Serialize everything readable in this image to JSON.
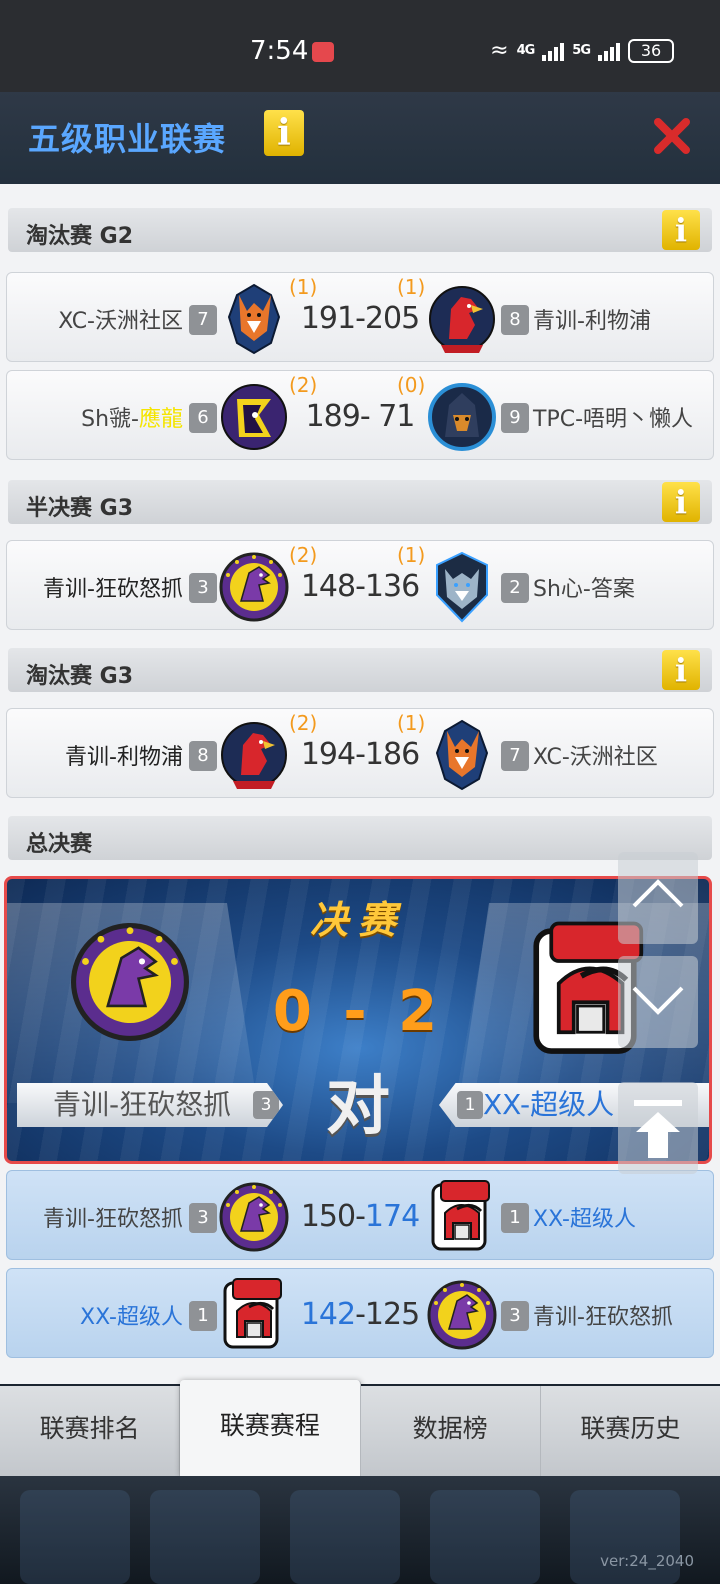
{
  "status_bar": {
    "time": "7:54",
    "network_a": "4G",
    "network_b": "5G",
    "wifi_label": "6",
    "battery": "36"
  },
  "header": {
    "title": "五级职业联赛",
    "info_icon": "i",
    "close_icon": "close-x"
  },
  "sections": [
    {
      "label": "淘汰赛 G2",
      "info": "i"
    },
    {
      "label": "半决赛 G3",
      "info": "i"
    },
    {
      "label": "淘汰赛 G3",
      "info": "i"
    },
    {
      "label": "总决赛"
    }
  ],
  "matches": [
    {
      "left_team": "XC-沃洲社区",
      "left_seed": "7",
      "left_wins": "(1)",
      "score_left": "191",
      "score_sep": "-",
      "score_right": "205",
      "right_wins": "(1)",
      "right_seed": "8",
      "right_team": "青训-利物浦"
    },
    {
      "left_team_prefix": "Sh虢-",
      "left_team_highlight": "應龍",
      "left_seed": "6",
      "left_wins": "(2)",
      "score_left": "189",
      "score_sep": "-",
      "score_right": " 71",
      "right_wins": "(0)",
      "right_seed": "9",
      "right_team": "TPC-唔明丶懒人"
    },
    {
      "left_team": "青训-狂砍怒抓",
      "left_seed": "3",
      "left_wins": "(2)",
      "score_left": "148",
      "score_sep": "-",
      "score_right": "136",
      "right_wins": "(1)",
      "right_seed": "2",
      "right_team": "Sh心-答案"
    },
    {
      "left_team": "青训-利物浦",
      "left_seed": "8",
      "left_wins": "(2)",
      "score_left": "194",
      "score_sep": "-",
      "score_right": "186",
      "right_wins": "(1)",
      "right_seed": "7",
      "right_team": "XC-沃洲社区"
    },
    {
      "left_team": "青训-狂砍怒抓",
      "left_seed": "3",
      "score_left": "150",
      "score_sep": "-",
      "score_right": "174",
      "right_seed": "1",
      "right_team": "XX-超级人"
    },
    {
      "left_team": "XX-超级人",
      "left_seed": "1",
      "score_left": "142",
      "score_sep": "-",
      "score_right": "125",
      "right_seed": "3",
      "right_team": "青训-狂砍怒抓"
    }
  ],
  "final": {
    "title": "决赛",
    "score": "0 - 2",
    "vs": "对",
    "left_team": "青训-狂砍怒抓",
    "left_seed": "3",
    "right_team": "XX-超级人",
    "right_seed": "1"
  },
  "controls": {
    "up_icon": "chevron-up-icon",
    "down_icon": "chevron-down-icon",
    "top_icon": "scroll-to-top-icon"
  },
  "tabs": [
    "联赛排名",
    "联赛赛程",
    "数据榜",
    "联赛历史"
  ],
  "active_tab": "联赛赛程",
  "version": "ver:24_2040",
  "colors": {
    "title_blue": "#5aa7ff",
    "wins_orange": "#f39a1e",
    "winner_blue": "#2a74d8",
    "final_border": "#e64a4a"
  }
}
